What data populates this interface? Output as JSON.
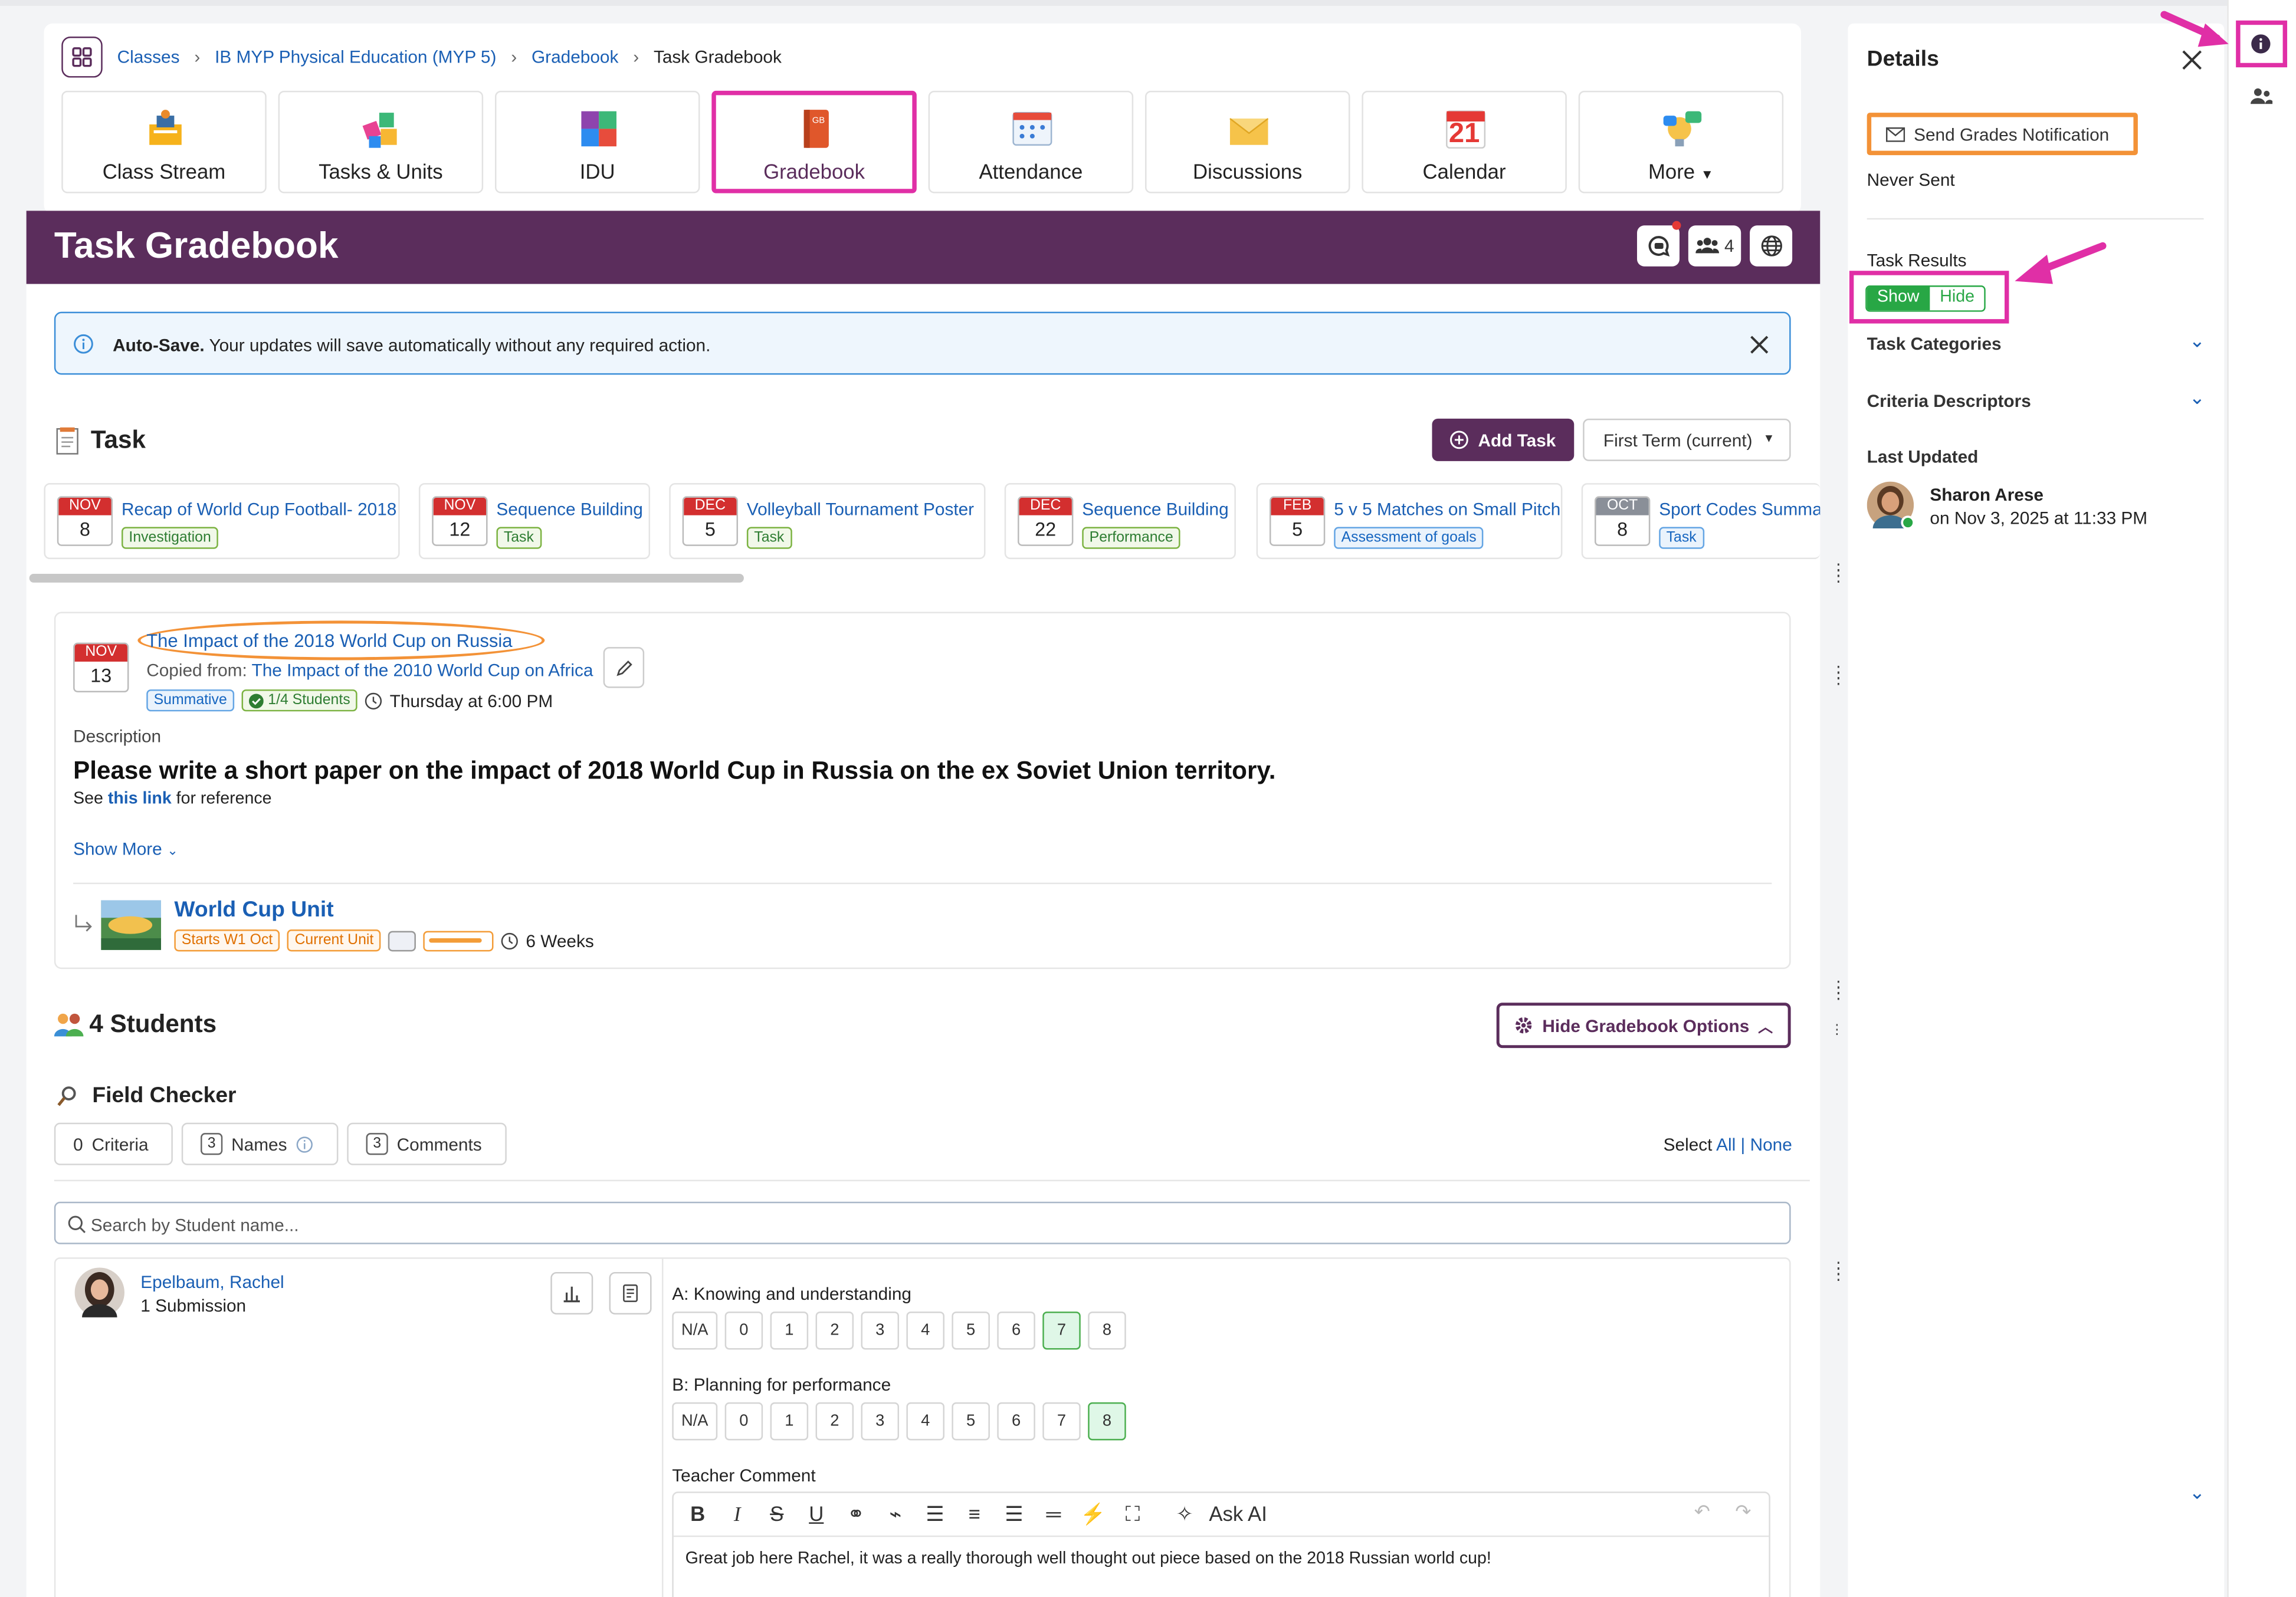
{
  "breadcrumb": [
    "Classes",
    "IB MYP Physical Education (MYP 5)",
    "Gradebook",
    "Task Gradebook"
  ],
  "nav": [
    {
      "label": "Class Stream",
      "icon": "class-stream-icon"
    },
    {
      "label": "Tasks & Units",
      "icon": "puzzle-icon"
    },
    {
      "label": "IDU",
      "icon": "idu-puzzle-icon"
    },
    {
      "label": "Gradebook",
      "icon": "gradebook-book-icon"
    },
    {
      "label": "Attendance",
      "icon": "attendance-icon"
    },
    {
      "label": "Discussions",
      "icon": "envelope-icon"
    },
    {
      "label": "Calendar",
      "icon": "calendar-icon",
      "cal_day": "21"
    },
    {
      "label": "More",
      "icon": "more-bulb-icon"
    }
  ],
  "page_title": "Task Gradebook",
  "banner": {
    "member_count": "4"
  },
  "autosave": {
    "title": "Auto-Save.",
    "text": "Your updates will save automatically without any required action."
  },
  "task_section": {
    "title": "Task",
    "add_label": "Add Task",
    "term": "First Term (current)"
  },
  "task_chips": [
    {
      "month": "NOV",
      "day": "8",
      "title": "Recap of World Cup Football- 2018",
      "tag": "Investigation"
    },
    {
      "month": "NOV",
      "day": "12",
      "title": "Sequence Building",
      "tag": "Task"
    },
    {
      "month": "DEC",
      "day": "5",
      "title": "Volleyball Tournament Poster",
      "tag": "Task"
    },
    {
      "month": "DEC",
      "day": "22",
      "title": "Sequence Building",
      "tag": "Performance"
    },
    {
      "month": "FEB",
      "day": "5",
      "title": "5 v 5 Matches on Small Pitch",
      "tag": "Assessment of goals"
    },
    {
      "month": "OCT",
      "day": "8",
      "title": "Sport Codes Summat",
      "tag": "Task"
    }
  ],
  "task_detail": {
    "month": "NOV",
    "day": "13",
    "title": "The Impact of the 2018 World Cup on Russia",
    "copied_label": "Copied from:",
    "copied_from": "The Impact of the 2010 World Cup on Africa",
    "tag_type": "Summative",
    "students_tag": "1/4 Students",
    "due": "Thursday at 6:00 PM",
    "desc_label": "Description",
    "desc_heading": "Please write a short paper on the impact of 2018 World Cup in Russia on the ex Soviet Union territory.",
    "see_prefix": "See",
    "see_link": "this link",
    "see_suffix": "for reference",
    "show_more": "Show More",
    "unit_title": "World Cup Unit",
    "unit_start": "Starts W1 Oct",
    "unit_current": "Current Unit",
    "unit_progress": 0.9,
    "unit_weeks": "6 Weeks"
  },
  "students_section": {
    "title": "4 Students",
    "options_btn": "Hide Gradebook Options"
  },
  "field_checker": {
    "title": "Field Checker",
    "criteria_num": "0",
    "criteria_label": "Criteria",
    "names_num": "3",
    "names_label": "Names",
    "comments_num": "3",
    "comments_label": "Comments",
    "select_label": "Select",
    "select_all": "All",
    "select_sep": "|",
    "select_none": "None"
  },
  "search": {
    "placeholder": "Search by Student name..."
  },
  "student": {
    "name": "Epelbaum, Rachel",
    "submissions": "1 Submission",
    "criteria": [
      {
        "label": "A: Knowing and understanding",
        "options": [
          "N/A",
          "0",
          "1",
          "2",
          "3",
          "4",
          "5",
          "6",
          "7",
          "8"
        ],
        "selected": "7"
      },
      {
        "label": "B: Planning for performance",
        "options": [
          "N/A",
          "0",
          "1",
          "2",
          "3",
          "4",
          "5",
          "6",
          "7",
          "8"
        ],
        "selected": "8"
      }
    ],
    "comment_label": "Teacher Comment",
    "ask_ai": "Ask AI",
    "comment": "Great job here Rachel, it was a really thorough well thought out piece based on the 2018 Russian world cup!"
  },
  "details": {
    "title": "Details",
    "send_btn": "Send Grades Notification",
    "never_sent": "Never Sent",
    "task_results_label": "Task Results",
    "show": "Show",
    "hide": "Hide",
    "task_categories": "Task Categories",
    "criteria_descriptors": "Criteria Descriptors",
    "last_updated": "Last Updated",
    "updated_by": "Sharon Arese",
    "updated_on": "on Nov 3, 2025 at 11:33 PM"
  },
  "colors": {
    "brand": "#5b2d5c",
    "highlight": "#e02fa6",
    "annotation_orange": "#f39237",
    "link": "#1a5fb4",
    "success": "#28a745"
  }
}
